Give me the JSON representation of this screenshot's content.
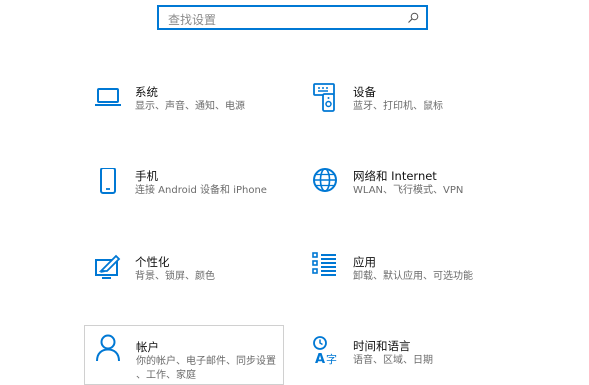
{
  "search": {
    "placeholder": "查找设置"
  },
  "tiles": [
    {
      "title": "系统",
      "desc": "显示、声音、通知、电源",
      "icon": "laptop-icon"
    },
    {
      "title": "设备",
      "desc": "蓝牙、打印机、鼠标",
      "icon": "devices-icon"
    },
    {
      "title": "手机",
      "desc": "连接 Android 设备和 iPhone",
      "icon": "phone-icon"
    },
    {
      "title": "网络和 Internet",
      "desc": "WLAN、飞行模式、VPN",
      "icon": "globe-icon"
    },
    {
      "title": "个性化",
      "desc": "背景、锁屏、颜色",
      "icon": "personalization-icon"
    },
    {
      "title": "应用",
      "desc": "卸载、默认应用、可选功能",
      "icon": "apps-list-icon"
    },
    {
      "title": "帐户",
      "desc": "你的帐户、电子邮件、同步设置、工作、家庭",
      "desc_line1": "你的帐户、电子邮件、同步设置",
      "desc_line2": "、工作、家庭",
      "icon": "person-icon"
    },
    {
      "title": "时间和语言",
      "desc": "语音、区域、日期",
      "icon": "time-language-icon"
    }
  ],
  "colors": {
    "accent": "#0078d4",
    "text_secondary": "#6b6b6b"
  }
}
